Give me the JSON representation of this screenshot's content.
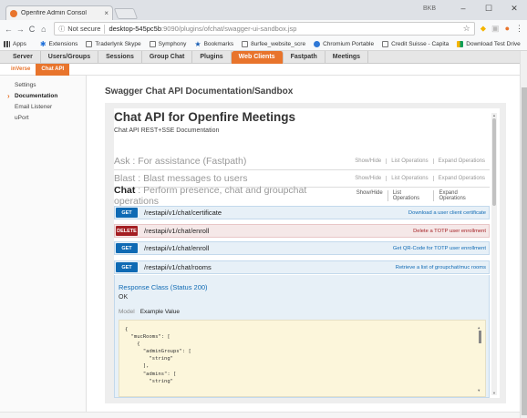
{
  "browser": {
    "tab_title": "Openfire Admin Consol",
    "tab_close": "×",
    "user_label": "BKB",
    "minimize": "–",
    "maximize": "☐",
    "close": "✕",
    "security_label": "Not secure",
    "url_host": "desktop-545pc5b",
    "url_path": ":9090/plugins/ofchat/swagger-ui-sandbox.jsp",
    "bookmarks": [
      {
        "label": "Apps",
        "icon": "apps-icon"
      },
      {
        "label": "Extensions",
        "icon": "extension-icon"
      },
      {
        "label": "Traderlynk Skype",
        "icon": "page-icon"
      },
      {
        "label": "Symphony",
        "icon": "page-icon"
      },
      {
        "label": "Bookmarks",
        "icon": "star-icon"
      },
      {
        "label": "8urfee_website_scre",
        "icon": "page-icon"
      },
      {
        "label": "Chromium Portable",
        "icon": "chromium-icon"
      },
      {
        "label": "Credit Suisse - Capita",
        "icon": "page-icon"
      },
      {
        "label": "Download Test Drive",
        "icon": "download-icon"
      }
    ],
    "bookmarks_more": "»"
  },
  "openfire": {
    "nav": [
      "Server",
      "Users/Groups",
      "Sessions",
      "Group Chat",
      "Plugins",
      "Web Clients",
      "Fastpath",
      "Meetings"
    ],
    "nav_active": "Web Clients",
    "subnav": [
      "inVerse",
      "Chat API"
    ],
    "subnav_active": "Chat API",
    "sidebar": [
      "Settings",
      "Documentation",
      "Email Listener",
      "uPort"
    ],
    "sidebar_active": "Documentation"
  },
  "main": {
    "page_title": "Swagger Chat API Documentation/Sandbox",
    "api_title": "Chat API for Openfire Meetings",
    "api_desc": "Chat API REST+SSE Documentation",
    "sections": [
      {
        "name": "Ask",
        "desc": " : For assistance (Fastpath)",
        "show_hide": "Show/Hide",
        "list_ops": "List Operations",
        "expand_ops": "Expand Operations"
      },
      {
        "name": "Blast",
        "desc": " : Blast messages to users",
        "show_hide": "Show/Hide",
        "list_ops": "List Operations",
        "expand_ops": "Expand Operations"
      },
      {
        "name": "Chat",
        "desc": " : Perform presence, chat and groupchat operations",
        "show_hide": "Show/Hide",
        "list_ops": "List Operations",
        "expand_ops": "Expand Operations"
      }
    ],
    "operations": [
      {
        "method": "GET",
        "path": "/restapi/v1/chat/certificate",
        "summary": "Download a user client certificate"
      },
      {
        "method": "DELETE",
        "path": "/restapi/v1/chat/enroll",
        "summary": "Delete a TOTP user enrollment"
      },
      {
        "method": "GET",
        "path": "/restapi/v1/chat/enroll",
        "summary": "Get QR-Code for TOTP user enrollment"
      },
      {
        "method": "GET",
        "path": "/restapi/v1/chat/rooms",
        "summary": "Retrieve a list of groupchat/muc rooms"
      }
    ],
    "response_class": "Response Class (Status 200)",
    "response_ok": "OK",
    "model_label": "Model",
    "example_label": "Example Value",
    "code_lines": [
      "{",
      "  \"mucRooms\": [",
      "    {",
      "      \"adminGroups\": [",
      "        \"string\"",
      "      ],",
      "      \"admins\": [",
      "        \"string\""
    ]
  },
  "colors": {
    "accent": "#e8742c",
    "get": "#0f6ab4",
    "delete": "#a41e22"
  }
}
